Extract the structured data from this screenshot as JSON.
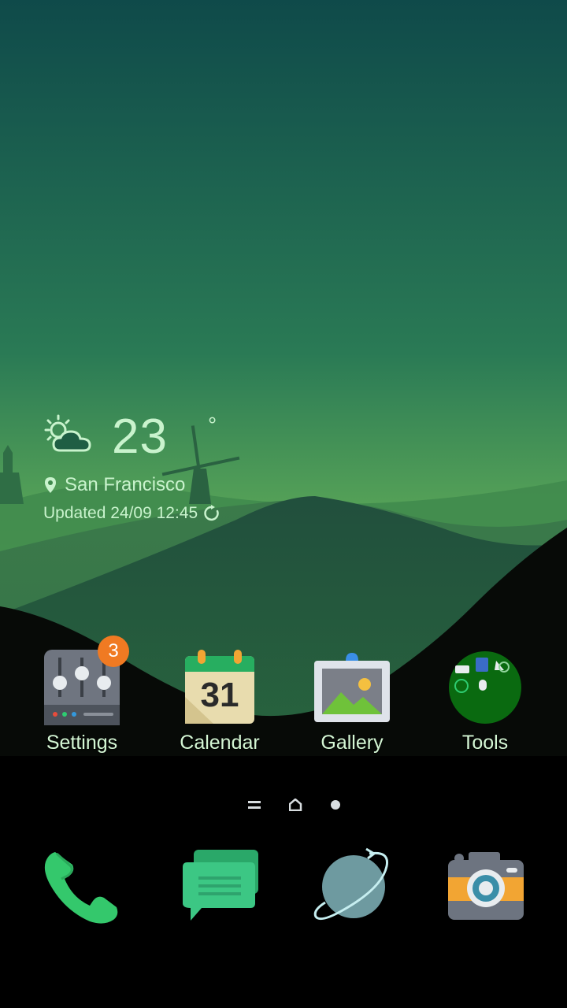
{
  "weather": {
    "temperature": "23",
    "unit": "°",
    "location": "San Francisco",
    "updated": "Updated 24/09 12:45",
    "icon": "partly-sunny-icon"
  },
  "apps": [
    {
      "label": "Settings",
      "badge": "3",
      "icon": "settings-icon"
    },
    {
      "label": "Calendar",
      "day": "31",
      "icon": "calendar-icon"
    },
    {
      "label": "Gallery",
      "icon": "gallery-icon"
    },
    {
      "label": "Tools",
      "icon": "tools-folder-icon"
    }
  ],
  "page_indicator": {
    "pages": [
      "menu",
      "home",
      "dot"
    ],
    "current": "home"
  },
  "dock": [
    {
      "name": "phone",
      "icon": "phone-icon"
    },
    {
      "name": "messages",
      "icon": "messages-icon"
    },
    {
      "name": "browser",
      "icon": "browser-icon"
    },
    {
      "name": "camera",
      "icon": "camera-icon"
    }
  ],
  "colors": {
    "sky_top": "#0f4a4a",
    "sky_bottom": "#6fb85a",
    "text": "#c9f3cd",
    "badge": "#f07a22"
  }
}
